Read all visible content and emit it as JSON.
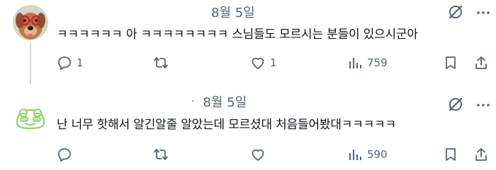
{
  "posts": [
    {
      "avatar_icon": "dog-with-glasses-avatar",
      "date": "8월 5일",
      "text": "ㅋㅋㅋㅋㅋㅋ 아 ㅋㅋㅋㅋㅋㅋㅋㅋ 스님들도 모르시는 분들이 있으시군아",
      "reply_count": "1",
      "repost_count": "",
      "like_count": "1",
      "view_count": "759"
    },
    {
      "avatar_icon": "frog-cartoon-avatar",
      "dot": "·",
      "date": "8월 5일",
      "text": "난 너무 핫해서 알긴알줄 알았는데 모르셨대 처음들어봤대ㅋㅋㅋㅋㅋ",
      "reply_count": "",
      "repost_count": "",
      "like_count": "",
      "view_count": "590"
    }
  ],
  "colors": {
    "text": "#0f1419",
    "muted": "#536471",
    "thread_line": "#cfd9de"
  }
}
